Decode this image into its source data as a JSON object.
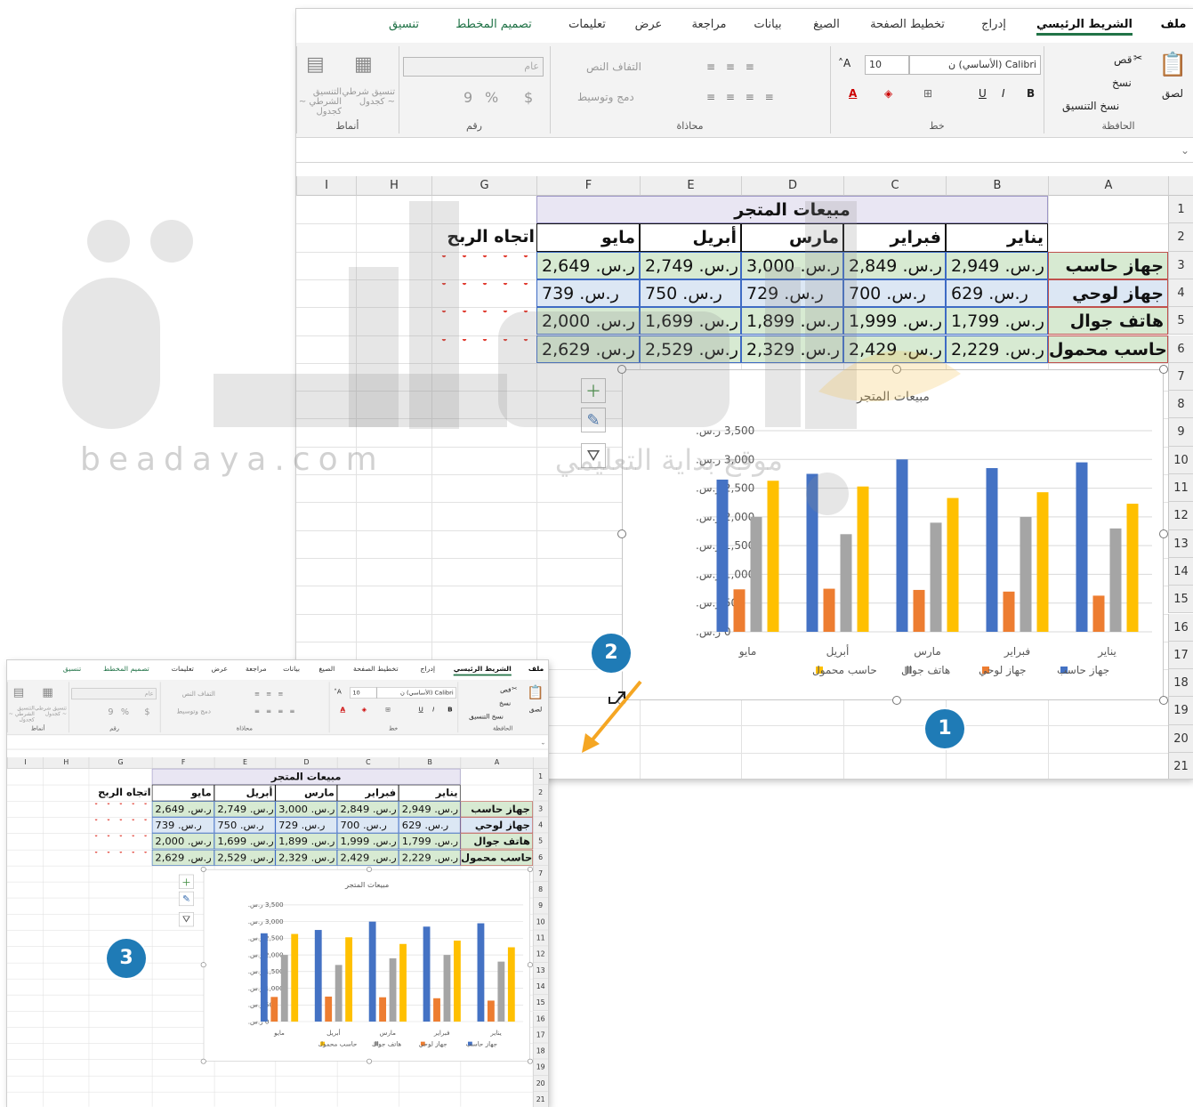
{
  "ribbon": {
    "tabs": [
      {
        "label": "ملف",
        "x": 986,
        "style": "bold"
      },
      {
        "label": "الشريط الرئيسي",
        "x": 886,
        "style": "active"
      },
      {
        "label": "إدراج",
        "x": 784,
        "style": ""
      },
      {
        "label": "تخطيط الصفحة",
        "x": 687,
        "style": ""
      },
      {
        "label": "الصيغ",
        "x": 596,
        "style": ""
      },
      {
        "label": "بيانات",
        "x": 530,
        "style": ""
      },
      {
        "label": "مراجعة",
        "x": 464,
        "style": ""
      },
      {
        "label": "عرض",
        "x": 396,
        "style": ""
      },
      {
        "label": "تعليمات",
        "x": 327,
        "style": ""
      },
      {
        "label": "تصميم المخطط",
        "x": 222,
        "style": "green"
      },
      {
        "label": "تنسيق",
        "x": 121,
        "style": "green"
      }
    ],
    "clipboard": {
      "label": "الحافظة",
      "paste": "لصق",
      "cut": "قص",
      "copy": "نسخ",
      "format_painter": "نسخ التنسيق"
    },
    "font": {
      "label": "خط",
      "font_name": "Calibri (الأساسي) ن",
      "font_size": "10",
      "bold": "B",
      "italic": "I",
      "underline": "U",
      "grow": "A˄",
      "shrink": "A˅"
    },
    "alignment": {
      "label": "محاذاة",
      "wrap": "التفاف النص",
      "merge": "دمج وتوسيط"
    },
    "number": {
      "label": "رقم",
      "format": "عام",
      "currency": "$",
      "percent": "%",
      "comma": "9"
    },
    "styles": {
      "label": "أنماط",
      "conditional": "التنسيق الشرطي ~ كجدول",
      "table": "تنسيق شرطي ~ كجدول"
    }
  },
  "columns": [
    "I",
    "H",
    "G",
    "F",
    "E",
    "D",
    "C",
    "B",
    "A"
  ],
  "rows": [
    "1",
    "2",
    "3",
    "4",
    "5",
    "6",
    "7",
    "8",
    "9",
    "10",
    "11",
    "12",
    "13",
    "14",
    "15",
    "16",
    "17",
    "18",
    "19",
    "20",
    "21"
  ],
  "table": {
    "title": "مبيعات المتجر",
    "headers": [
      "يناير",
      "فبراير",
      "مارس",
      "أبريل",
      "مايو"
    ],
    "trend_header": "اتجاه الربح",
    "products": [
      {
        "name": "جهاز حاسب",
        "values": [
          "ر.س. 2,949",
          "ر.س. 2,849",
          "ر.س. 3,000",
          "ر.س. 2,749",
          "ر.س. 2,649"
        ],
        "fill": "#d7ead2"
      },
      {
        "name": "جهاز لوحي",
        "values": [
          "ر.س. 629",
          "ر.س. 700",
          "ر.س. 729",
          "ر.س. 750",
          "ر.س. 739"
        ],
        "fill": "#dce7f4"
      },
      {
        "name": "هاتف جوال",
        "values": [
          "ر.س. 1,799",
          "ر.س. 1,999",
          "ر.س. 1,899",
          "ر.س. 1,699",
          "ر.س. 2,000"
        ],
        "fill": "#d7ead2"
      },
      {
        "name": "حاسب محمول",
        "values": [
          "ر.س. 2,229",
          "ر.س. 2,429",
          "ر.س. 2,329",
          "ر.س. 2,529",
          "ر.س. 2,629"
        ],
        "fill": "#d7ead2"
      }
    ]
  },
  "chart_data": {
    "type": "bar",
    "title": "مبيعات المتجر",
    "categories": [
      "يناير",
      "فبراير",
      "مارس",
      "أبريل",
      "مايو"
    ],
    "series": [
      {
        "name": "جهاز حاسب",
        "color": "#4472c4",
        "values": [
          2949,
          2849,
          3000,
          2749,
          2649
        ]
      },
      {
        "name": "جهاز لوحي",
        "color": "#ed7d31",
        "values": [
          629,
          700,
          729,
          750,
          739
        ]
      },
      {
        "name": "هاتف جوال",
        "color": "#a5a5a5",
        "values": [
          1799,
          1999,
          1899,
          1699,
          2000
        ]
      },
      {
        "name": "حاسب محمول",
        "color": "#ffc000",
        "values": [
          2229,
          2429,
          2329,
          2529,
          2629
        ]
      }
    ],
    "ylim": [
      0,
      3500
    ],
    "yticks": [
      "3,500 ر.س.",
      "3,000 ر.س.",
      "2,500 ر.س.",
      "2,000 ر.س.",
      "1,500 ر.س.",
      "1,000 ر.س.",
      "500 ر.س.",
      "0 ر.س."
    ],
    "grid": true,
    "legend": "bottom",
    "categories_reversed": true
  },
  "watermark": {
    "text": "beadaya.com",
    "subtitle": "موقع بداية التعليمي"
  },
  "badges": [
    "1",
    "2",
    "3"
  ]
}
